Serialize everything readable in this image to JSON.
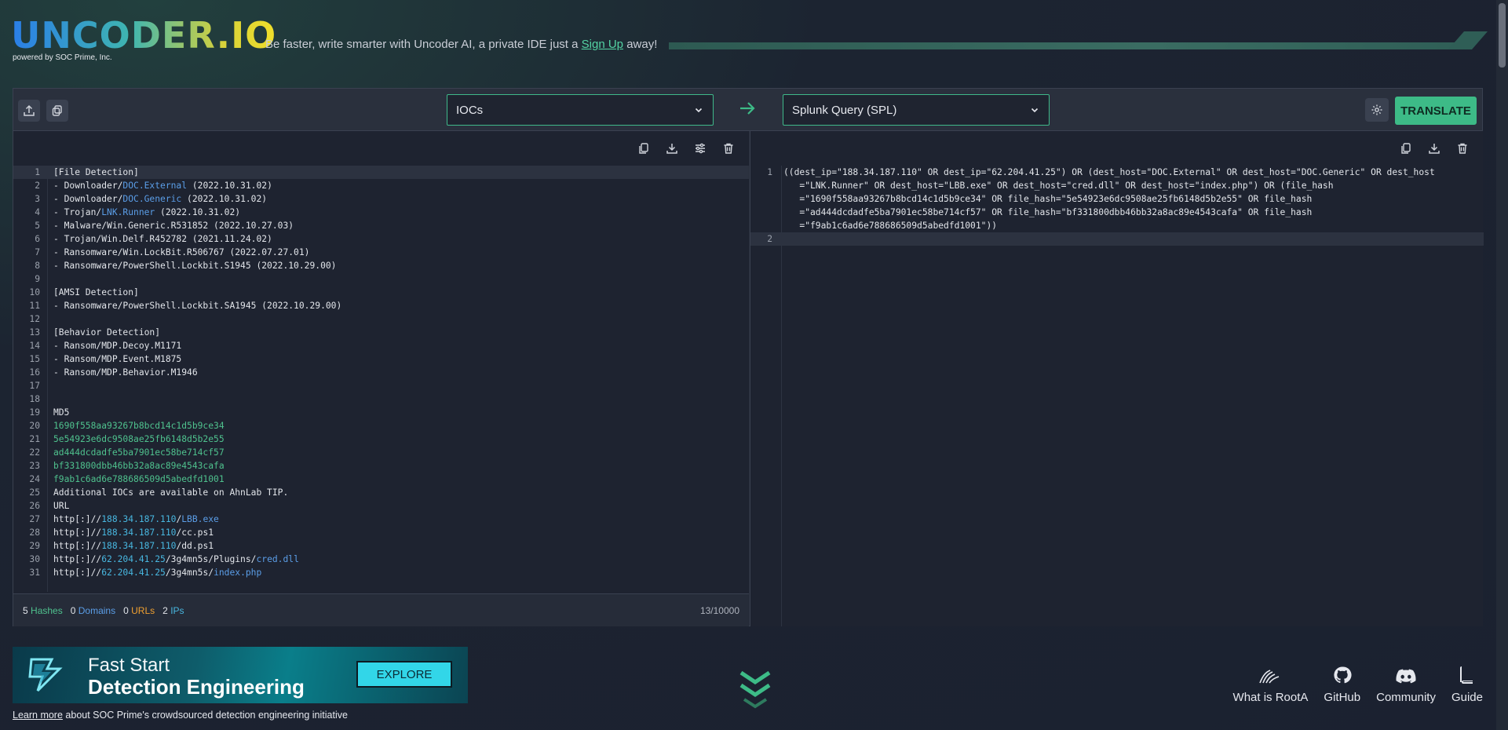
{
  "header": {
    "logo": "UNCODER.IO",
    "powered_by": "powered by SOC Prime, Inc.",
    "tagline_before": "Be faster, write smarter with Uncoder AI, a private IDE just a ",
    "tagline_link": "Sign Up",
    "tagline_after": " away!"
  },
  "toolbar": {
    "source_select": "IOCs",
    "target_select": "Splunk Query (SPL)",
    "translate_label": "TRANSLATE"
  },
  "icons": [
    "upload-icon",
    "copy-icon",
    "arrow-right-icon",
    "gear-icon",
    "download-icon",
    "sliders-icon",
    "trash-icon",
    "chevron-down-icon"
  ],
  "colors": {
    "accent": "#3dbb87",
    "hash": "#4fc28e",
    "domain": "#5b9ee8",
    "url": "#f0a030",
    "ip": "#48b7e0"
  },
  "left_editor": {
    "lines": [
      {
        "n": "1",
        "parts": [
          {
            "t": "[File Detection]",
            "c": ""
          }
        ]
      },
      {
        "n": "2",
        "parts": [
          {
            "t": "- Downloader/",
            "c": ""
          },
          {
            "t": "DOC.External",
            "c": "blue"
          },
          {
            "t": " (2022.10.31.02)",
            "c": ""
          }
        ]
      },
      {
        "n": "3",
        "parts": [
          {
            "t": "- Downloader/",
            "c": ""
          },
          {
            "t": "DOC.Generic",
            "c": "blue"
          },
          {
            "t": " (2022.10.31.02)",
            "c": ""
          }
        ]
      },
      {
        "n": "4",
        "parts": [
          {
            "t": "- Trojan/",
            "c": ""
          },
          {
            "t": "LNK.Runner",
            "c": "blue"
          },
          {
            "t": " (2022.10.31.02)",
            "c": ""
          }
        ]
      },
      {
        "n": "5",
        "parts": [
          {
            "t": "- Malware/Win.Generic.R531852 (2022.10.27.03)",
            "c": ""
          }
        ]
      },
      {
        "n": "6",
        "parts": [
          {
            "t": "- Trojan/Win.Delf.R452782 (2021.11.24.02)",
            "c": ""
          }
        ]
      },
      {
        "n": "7",
        "parts": [
          {
            "t": "- Ransomware/Win.LockBit.R506767 (2022.07.27.01)",
            "c": ""
          }
        ]
      },
      {
        "n": "8",
        "parts": [
          {
            "t": "- Ransomware/PowerShell.Lockbit.S1945 (2022.10.29.00)",
            "c": ""
          }
        ]
      },
      {
        "n": "9",
        "parts": [
          {
            "t": "",
            "c": ""
          }
        ]
      },
      {
        "n": "10",
        "parts": [
          {
            "t": "[AMSI Detection]",
            "c": ""
          }
        ]
      },
      {
        "n": "11",
        "parts": [
          {
            "t": "- Ransomware/PowerShell.Lockbit.SA1945 (2022.10.29.00)",
            "c": ""
          }
        ]
      },
      {
        "n": "12",
        "parts": [
          {
            "t": "",
            "c": ""
          }
        ]
      },
      {
        "n": "13",
        "parts": [
          {
            "t": "[Behavior Detection]",
            "c": ""
          }
        ]
      },
      {
        "n": "14",
        "parts": [
          {
            "t": "- Ransom/MDP.Decoy.M1171",
            "c": ""
          }
        ]
      },
      {
        "n": "15",
        "parts": [
          {
            "t": "- Ransom/MDP.Event.M1875",
            "c": ""
          }
        ]
      },
      {
        "n": "16",
        "parts": [
          {
            "t": "- Ransom/MDP.Behavior.M1946",
            "c": ""
          }
        ]
      },
      {
        "n": "17",
        "parts": [
          {
            "t": "",
            "c": ""
          }
        ]
      },
      {
        "n": "18",
        "parts": [
          {
            "t": "",
            "c": ""
          }
        ]
      },
      {
        "n": "19",
        "parts": [
          {
            "t": "MD5",
            "c": ""
          }
        ]
      },
      {
        "n": "20",
        "parts": [
          {
            "t": "1690f558aa93267b8bcd14c1d5b9ce34",
            "c": "hash"
          }
        ]
      },
      {
        "n": "21",
        "parts": [
          {
            "t": "5e54923e6dc9508ae25fb6148d5b2e55",
            "c": "hash"
          }
        ]
      },
      {
        "n": "22",
        "parts": [
          {
            "t": "ad444dcdadfe5ba7901ec58be714cf57",
            "c": "hash"
          }
        ]
      },
      {
        "n": "23",
        "parts": [
          {
            "t": "bf331800dbb46bb32a8ac89e4543cafa",
            "c": "hash"
          }
        ]
      },
      {
        "n": "24",
        "parts": [
          {
            "t": "f9ab1c6ad6e788686509d5abedfd1001",
            "c": "hash"
          }
        ]
      },
      {
        "n": "25",
        "parts": [
          {
            "t": "Additional IOCs are available on AhnLab TIP.",
            "c": ""
          }
        ]
      },
      {
        "n": "26",
        "parts": [
          {
            "t": "URL",
            "c": ""
          }
        ]
      },
      {
        "n": "27",
        "parts": [
          {
            "t": "http[:]//",
            "c": ""
          },
          {
            "t": "188.34.187.110",
            "c": "cyan"
          },
          {
            "t": "/",
            "c": ""
          },
          {
            "t": "LBB.exe",
            "c": "blue"
          }
        ]
      },
      {
        "n": "28",
        "parts": [
          {
            "t": "http[:]//",
            "c": ""
          },
          {
            "t": "188.34.187.110",
            "c": "cyan"
          },
          {
            "t": "/cc.ps1",
            "c": ""
          }
        ]
      },
      {
        "n": "29",
        "parts": [
          {
            "t": "http[:]//",
            "c": ""
          },
          {
            "t": "188.34.187.110",
            "c": "cyan"
          },
          {
            "t": "/dd.ps1",
            "c": ""
          }
        ]
      },
      {
        "n": "30",
        "parts": [
          {
            "t": "http[:]//",
            "c": ""
          },
          {
            "t": "62.204.41.25",
            "c": "cyan"
          },
          {
            "t": "/3g4mn5s/Plugins/",
            "c": ""
          },
          {
            "t": "cred.dll",
            "c": "blue"
          }
        ]
      },
      {
        "n": "31",
        "parts": [
          {
            "t": "http[:]//",
            "c": ""
          },
          {
            "t": "62.204.41.25",
            "c": "cyan"
          },
          {
            "t": "/3g4mn5s/",
            "c": ""
          },
          {
            "t": "index.php",
            "c": "blue"
          }
        ]
      }
    ]
  },
  "stats": {
    "hashes_count": "5",
    "hashes_label": "Hashes",
    "domains_count": "0",
    "domains_label": "Domains",
    "urls_count": "0",
    "urls_label": "URLs",
    "ips_count": "2",
    "ips_label": "IPs",
    "counter": "13/10000"
  },
  "right_editor": {
    "lines": [
      {
        "n": "1",
        "text": "((dest_ip=\"188.34.187.110\" OR dest_ip=\"62.204.41.25\") OR (dest_host=\"DOC.External\" OR dest_host=\"DOC.Generic\" OR dest_host\n   =\"LNK.Runner\" OR dest_host=\"LBB.exe\" OR dest_host=\"cred.dll\" OR dest_host=\"index.php\") OR (file_hash\n   =\"1690f558aa93267b8bcd14c1d5b9ce34\" OR file_hash=\"5e54923e6dc9508ae25fb6148d5b2e55\" OR file_hash\n   =\"ad444dcdadfe5ba7901ec58be714cf57\" OR file_hash=\"bf331800dbb46bb32a8ac89e4543cafa\" OR file_hash\n   =\"f9ab1c6ad6e788686509d5abedfd1001\"))"
      },
      {
        "n": "2",
        "text": ""
      }
    ]
  },
  "banner": {
    "line1": "Fast Start",
    "line2": "Detection Engineering",
    "button": "EXPLORE",
    "learn_link": "Learn more",
    "learn_rest": " about SOC Prime's crowdsourced detection engineering initiative"
  },
  "footer_links": [
    {
      "label": "What is RootA",
      "icon": "roota-icon"
    },
    {
      "label": "GitHub",
      "icon": "github-icon"
    },
    {
      "label": "Community",
      "icon": "discord-icon"
    },
    {
      "label": "Guide",
      "icon": "book-icon"
    }
  ]
}
